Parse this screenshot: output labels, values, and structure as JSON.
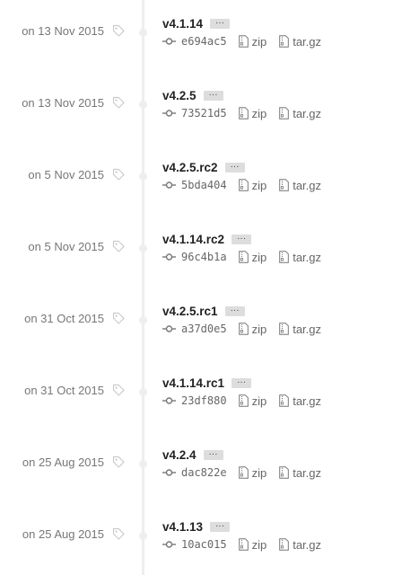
{
  "tags": [
    {
      "date": "on 13 Nov 2015",
      "name": "v4.1.14",
      "sha": "e694ac5",
      "zip": "zip",
      "tar": "tar.gz",
      "ellipsis": "···"
    },
    {
      "date": "on 13 Nov 2015",
      "name": "v4.2.5",
      "sha": "73521d5",
      "zip": "zip",
      "tar": "tar.gz",
      "ellipsis": "···"
    },
    {
      "date": "on 5 Nov 2015",
      "name": "v4.2.5.rc2",
      "sha": "5bda404",
      "zip": "zip",
      "tar": "tar.gz",
      "ellipsis": "···"
    },
    {
      "date": "on 5 Nov 2015",
      "name": "v4.1.14.rc2",
      "sha": "96c4b1a",
      "zip": "zip",
      "tar": "tar.gz",
      "ellipsis": "···"
    },
    {
      "date": "on 31 Oct 2015",
      "name": "v4.2.5.rc1",
      "sha": "a37d0e5",
      "zip": "zip",
      "tar": "tar.gz",
      "ellipsis": "···"
    },
    {
      "date": "on 31 Oct 2015",
      "name": "v4.1.14.rc1",
      "sha": "23df880",
      "zip": "zip",
      "tar": "tar.gz",
      "ellipsis": "···"
    },
    {
      "date": "on 25 Aug 2015",
      "name": "v4.2.4",
      "sha": "dac822e",
      "zip": "zip",
      "tar": "tar.gz",
      "ellipsis": "···"
    },
    {
      "date": "on 25 Aug 2015",
      "name": "v4.1.13",
      "sha": "10ac015",
      "zip": "zip",
      "tar": "tar.gz",
      "ellipsis": "···"
    }
  ],
  "icons": {
    "tag": "tag-icon",
    "commit": "git-commit-icon",
    "file": "file-zip-icon"
  },
  "colors": {
    "timeline": "#eeeeee",
    "ellipsis_bg": "#dddddd",
    "muted_text": "#777777"
  }
}
